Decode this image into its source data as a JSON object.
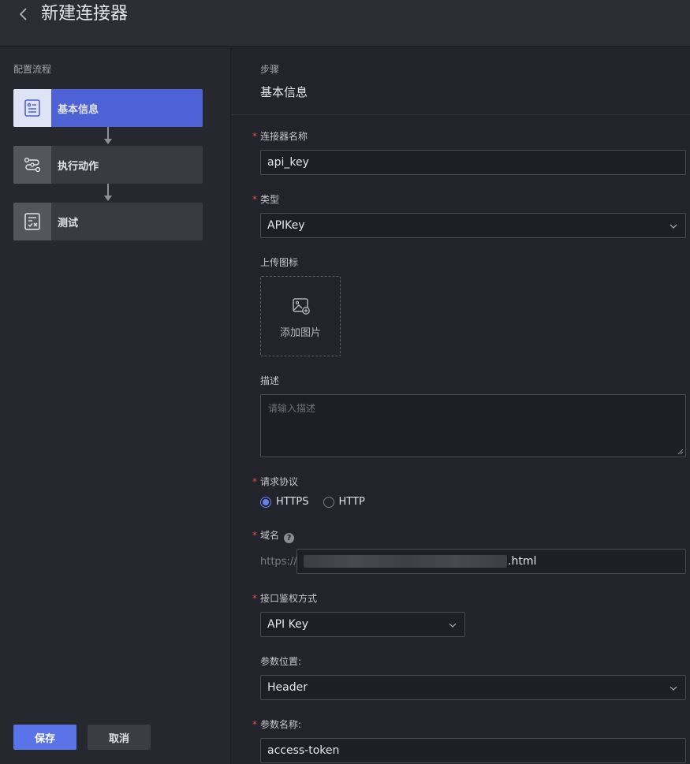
{
  "header": {
    "title": "新建连接器",
    "back_icon": "chevron-left-icon"
  },
  "sidebar": {
    "title": "配置流程",
    "steps": [
      {
        "label": "基本信息",
        "icon": "document-list-icon",
        "active": true
      },
      {
        "label": "执行动作",
        "icon": "workflow-icon",
        "active": false
      },
      {
        "label": "测试",
        "icon": "checklist-icon",
        "active": false
      }
    ],
    "save_label": "保存",
    "cancel_label": "取消"
  },
  "main": {
    "step_caption": "步骤",
    "step_current": "基本信息",
    "fields": {
      "name": {
        "label": "连接器名称",
        "value": "api_key",
        "required": true
      },
      "type": {
        "label": "类型",
        "value": "APIKey",
        "required": true
      },
      "icon_upload": {
        "label": "上传图标",
        "button_text": "添加图片"
      },
      "description": {
        "label": "描述",
        "placeholder": "请输入描述"
      },
      "protocol": {
        "label": "请求协议",
        "required": true,
        "options": [
          "HTTPS",
          "HTTP"
        ],
        "selected": "HTTPS"
      },
      "domain": {
        "label": "域名",
        "prefix": "https://",
        "value_suffix": ".html",
        "required": true
      },
      "auth": {
        "label": "接口鉴权方式",
        "value": "API Key",
        "required": true
      },
      "param_location": {
        "label": "参数位置:",
        "value": "Header"
      },
      "param_name": {
        "label": "参数名称:",
        "value": "access-token",
        "required": true
      }
    }
  },
  "colors": {
    "accent": "#4c62d6",
    "primary_button": "#5b73e8",
    "required": "#e4514a",
    "background": "#23242b"
  }
}
